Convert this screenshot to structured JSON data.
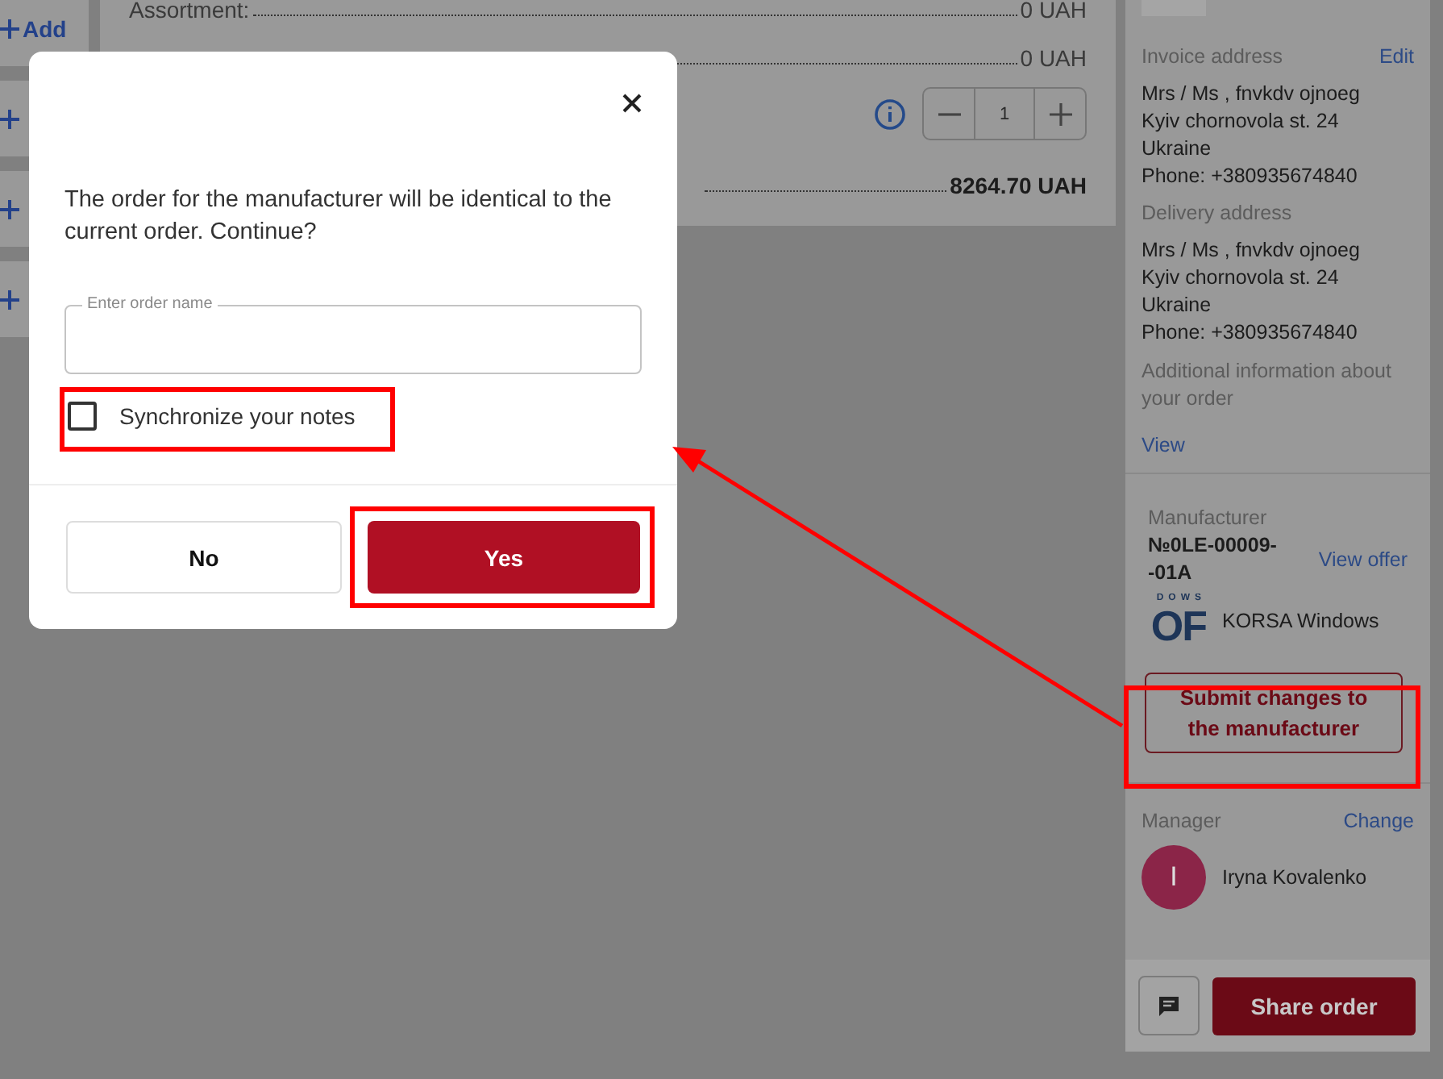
{
  "add_buttons": [
    {
      "kind": "labeled",
      "label": "Add"
    },
    {
      "kind": "icon"
    },
    {
      "kind": "icon"
    },
    {
      "kind": "icon"
    }
  ],
  "summary": {
    "rows": [
      {
        "kind": "line",
        "label": "Assortment:",
        "value": "0 UAH"
      },
      {
        "kind": "line",
        "value": "0 UAH"
      },
      {
        "kind": "quantity",
        "value": "1"
      },
      {
        "kind": "total",
        "value": "8264.70 UAH"
      }
    ]
  },
  "sidebar": {
    "invoice": {
      "title": "Invoice address",
      "action": "Edit",
      "lines": [
        "Mrs / Ms , fnvkdv ojnoeg",
        "Kyiv chornovola st. 24",
        "Ukraine",
        "Phone: +380935674840"
      ]
    },
    "delivery": {
      "title": "Delivery address",
      "lines": [
        "Mrs / Ms , fnvkdv ojnoeg",
        "Kyiv chornovola st. 24",
        "Ukraine",
        "Phone: +380935674840"
      ]
    },
    "additional": {
      "title": "Additional information about your order",
      "action": "View"
    },
    "manufacturer": {
      "title": "Manufacturer",
      "number": "№0LE-00009-\n-01A",
      "action": "View offer",
      "logo_top": "DOWS",
      "logo_main": "OF",
      "name": "KORSA Windows",
      "submit": "Submit changes to the manufacturer"
    },
    "manager": {
      "title": "Manager",
      "action": "Change",
      "initial": "I",
      "name": "Iryna Kovalenko"
    },
    "share": "Share order"
  },
  "modal": {
    "message": "The order for the manufacturer will be identical to the current order. Continue?",
    "field": {
      "placeholder": "Enter order name"
    },
    "checkbox": {
      "label": "Synchronize your notes",
      "checked": false
    },
    "buttons": [
      {
        "kind": "secondary",
        "label": "No"
      },
      {
        "kind": "primary",
        "label": "Yes"
      }
    ]
  }
}
